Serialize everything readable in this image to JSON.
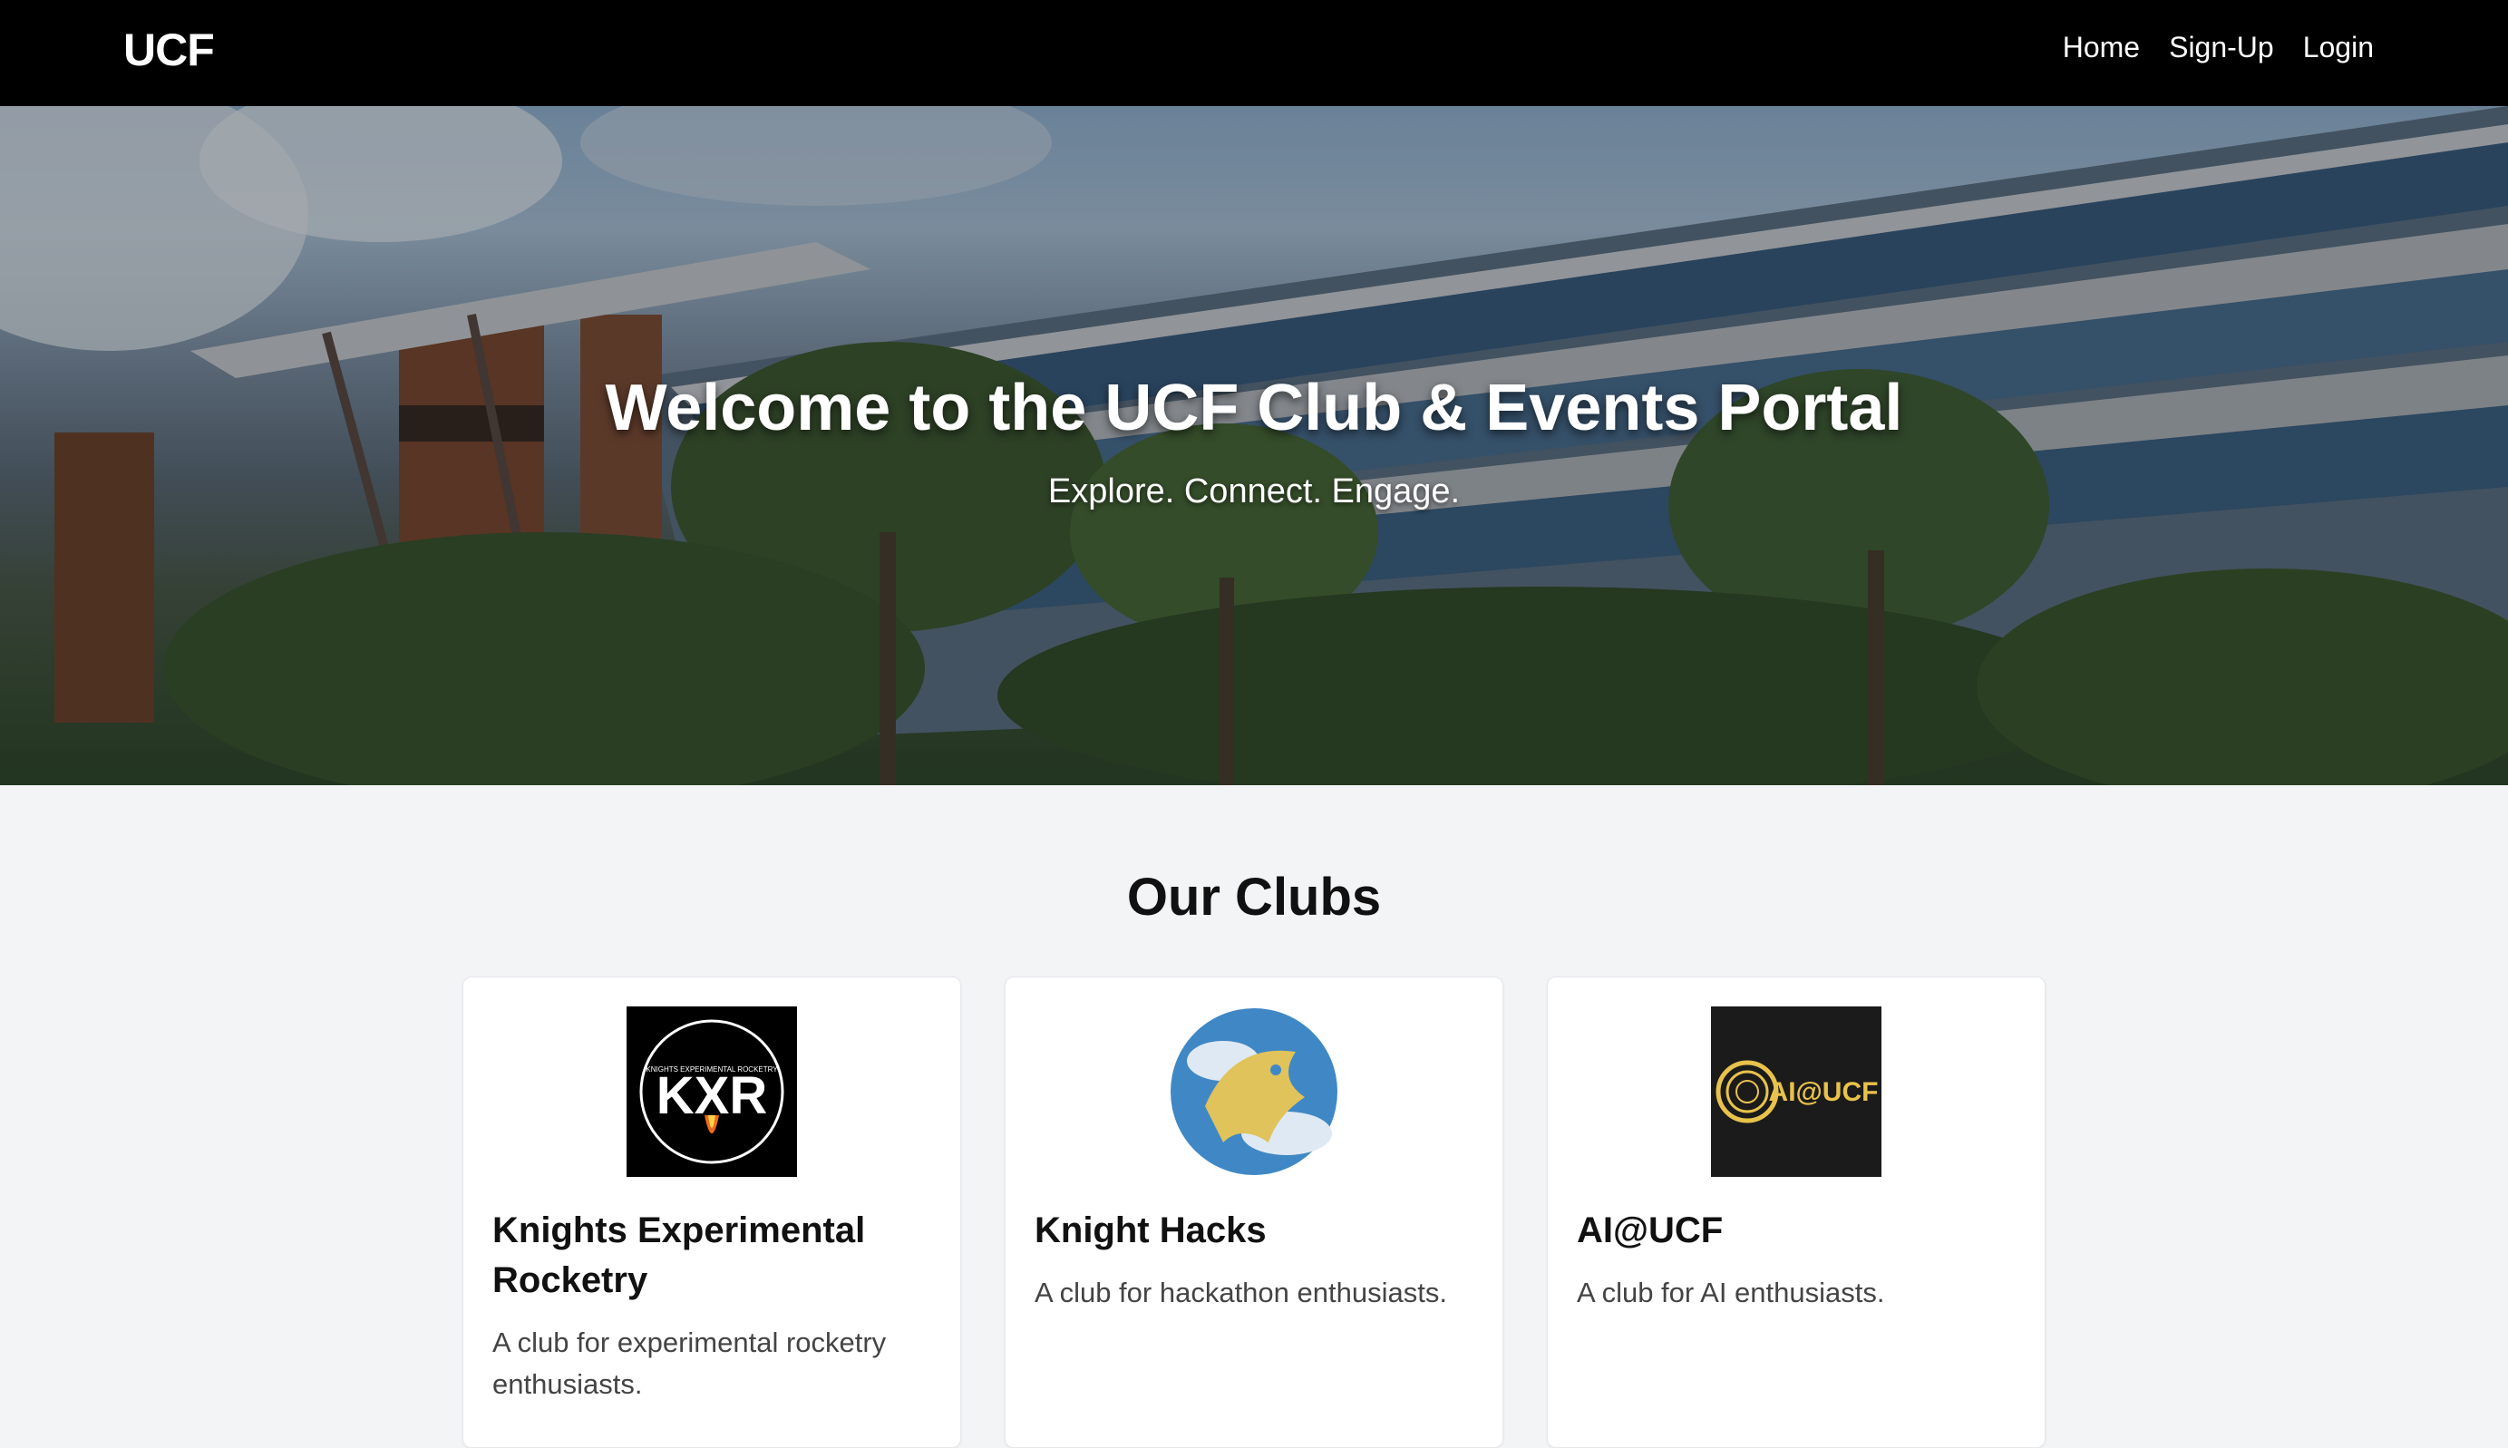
{
  "nav": {
    "brand": "UCF",
    "links": [
      "Home",
      "Sign-Up",
      "Login"
    ]
  },
  "hero": {
    "title": "Welcome to the UCF Club & Events Portal",
    "subtitle": "Explore. Connect. Engage."
  },
  "clubs_section": {
    "title": "Our Clubs",
    "clubs": [
      {
        "name": "Knights Experimental Rocketry",
        "description": "A club for experimental rocketry enthusiasts.",
        "logo_text": "KXR",
        "logo_small_text": "KNIGHTS EXPERIMENTAL ROCKETRY"
      },
      {
        "name": "Knight Hacks",
        "description": "A club for hackathon enthusiasts."
      },
      {
        "name": "AI@UCF",
        "description": "A club for AI enthusiasts.",
        "logo_text": "AI@UCF"
      }
    ]
  },
  "colors": {
    "navbar_bg": "#000000",
    "page_bg": "#f3f4f6",
    "accent_gold": "#e8c24a"
  }
}
